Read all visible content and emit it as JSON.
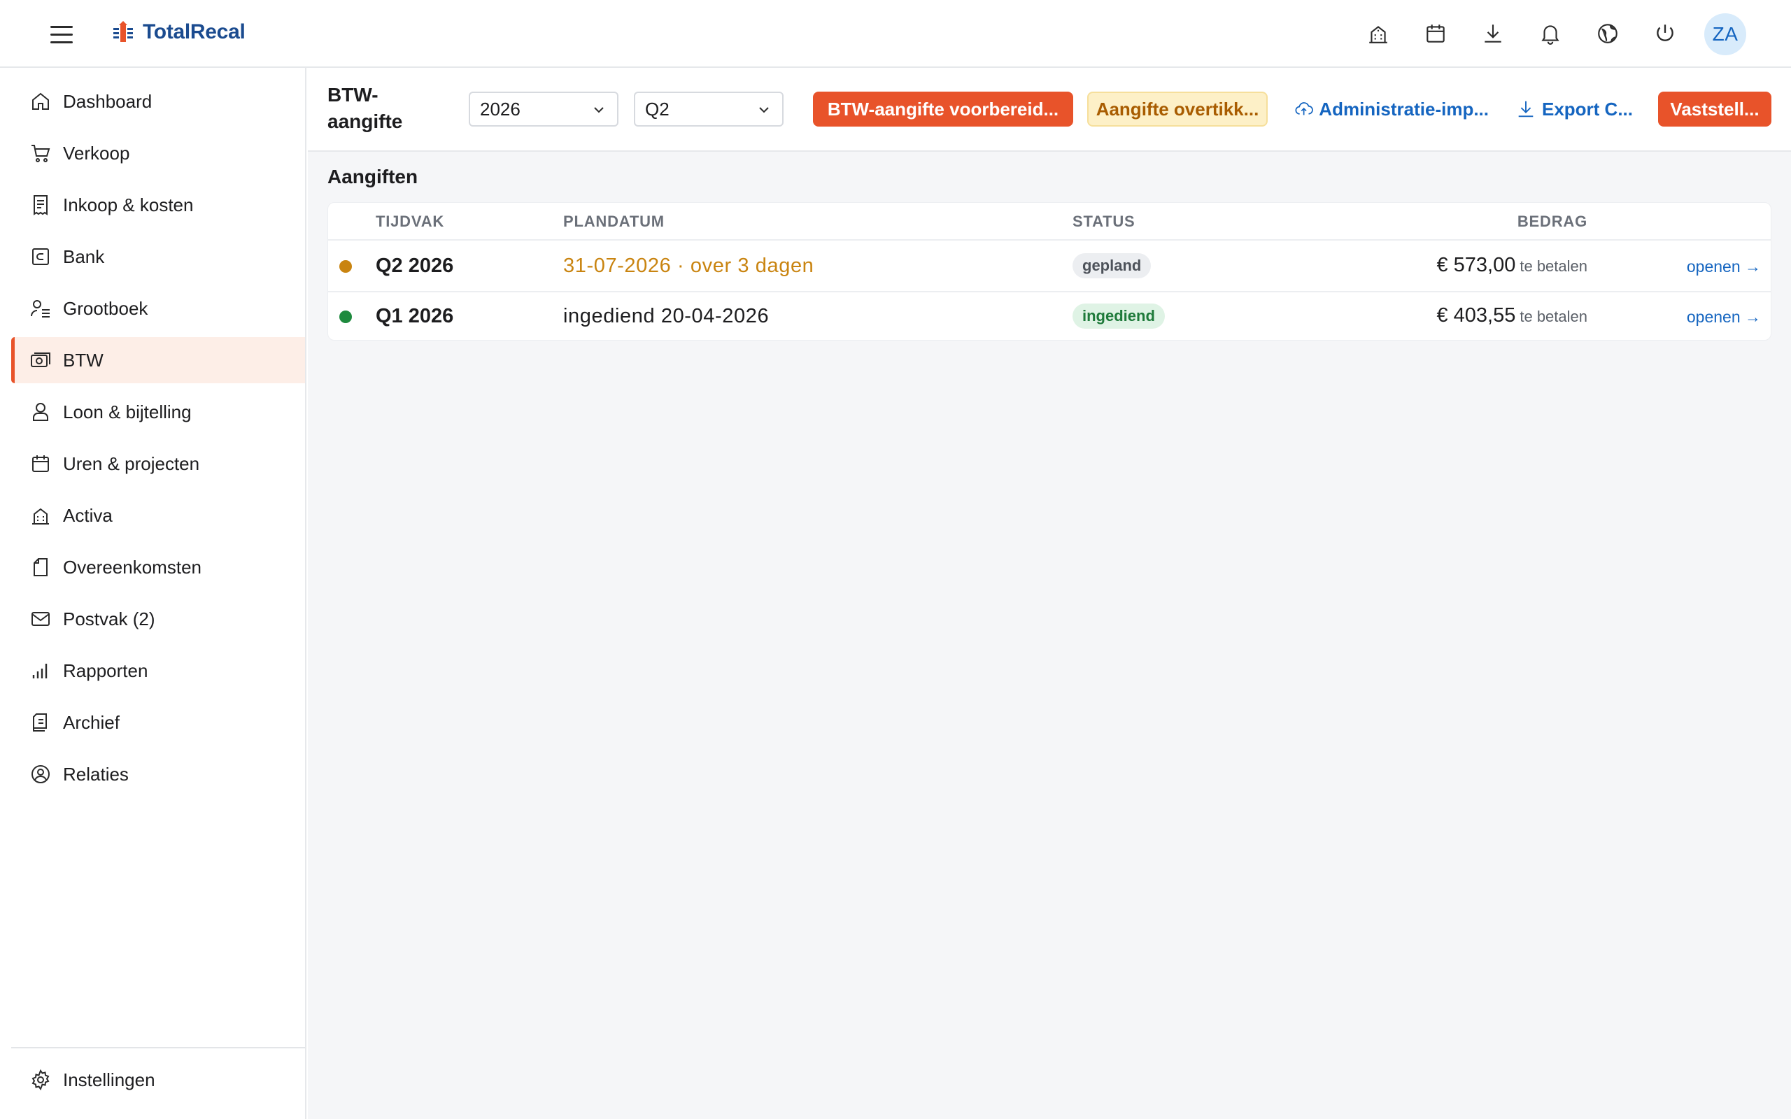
{
  "app": {
    "brand_name": "TotalRecal",
    "user_initials": "ZA"
  },
  "top_icons": [
    "buildings-icon",
    "calendar-icon",
    "download-icon",
    "bell-icon",
    "globe-icon",
    "power-icon"
  ],
  "sidebar": {
    "items": [
      {
        "label": "Dashboard",
        "icon": "home-icon"
      },
      {
        "label": "Verkoop",
        "icon": "cart-icon"
      },
      {
        "label": "Inkoop & kosten",
        "icon": "receipt-icon"
      },
      {
        "label": "Bank",
        "icon": "bank-card-icon"
      },
      {
        "label": "Grootboek",
        "icon": "ledger-icon"
      },
      {
        "label": "BTW",
        "icon": "money-icon",
        "active": true
      },
      {
        "label": "Loon & bijtelling",
        "icon": "person-icon"
      },
      {
        "label": "Uren & projecten",
        "icon": "calendar-icon"
      },
      {
        "label": "Activa",
        "icon": "buildings-icon"
      },
      {
        "label": "Overeenkomsten",
        "icon": "document-icon"
      },
      {
        "label": "Postvak (2)",
        "icon": "mail-icon"
      },
      {
        "label": "Rapporten",
        "icon": "bar-chart-icon"
      },
      {
        "label": "Archief",
        "icon": "archive-icon"
      },
      {
        "label": "Relaties",
        "icon": "contact-icon"
      }
    ],
    "settings_label": "Instellingen"
  },
  "toolbar": {
    "page_title": "BTW-aangifte",
    "year_select": "2026",
    "quarter_select": "Q2",
    "prepare_button": "BTW-aangifte voorbereid...",
    "review_button": "Aangifte overtikk...",
    "import_button": "Administratie-imp...",
    "export_button": "Export C...",
    "finalize_button": "Vaststell..."
  },
  "main": {
    "section_title": "Aangiften",
    "columns": [
      "TIJDVAK",
      "PLANDATUM",
      "STATUS",
      "BEDRAG"
    ],
    "rows": [
      {
        "period": "Q2 2026",
        "date": "31-07-2026 · over 3 dagen",
        "status": "gepland",
        "amount": "€ 573,00",
        "amount_suffix": "te betalen",
        "action": "openen →",
        "dot_color": "#c98410",
        "date_color": "#c98410",
        "badge_bg": "#eceef1",
        "badge_color": "#4d525a"
      },
      {
        "period": "Q1 2026",
        "date": "ingediend 20-04-2026",
        "status": "ingediend",
        "amount": "€ 403,55",
        "amount_suffix": "te betalen",
        "action": "openen →",
        "dot_color": "#1e8a3e",
        "date_color": "#1d1d1f",
        "badge_bg": "#dff3e5",
        "badge_color": "#1e7a3a"
      }
    ]
  },
  "colors": {
    "accent": "#e8532a",
    "link": "#1565c0",
    "warning_bg": "#fdf0c7"
  }
}
